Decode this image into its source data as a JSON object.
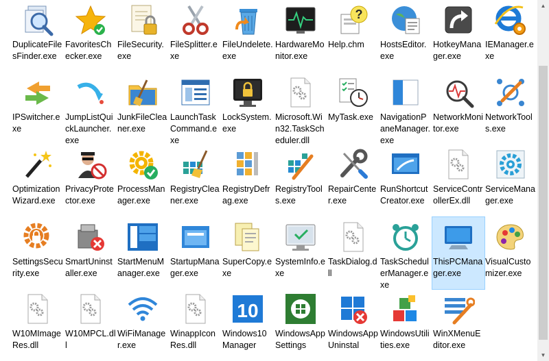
{
  "files": [
    {
      "name": "DuplicateFilesFinder.exe",
      "icon": "magnifier-files-icon"
    },
    {
      "name": "FavoritesChecker.exe",
      "icon": "star-check-icon"
    },
    {
      "name": "FileSecurity.exe",
      "icon": "document-lock-icon"
    },
    {
      "name": "FileSplitter.exe",
      "icon": "scissors-icon"
    },
    {
      "name": "FileUndelete.exe",
      "icon": "recycle-bin-undo-icon"
    },
    {
      "name": "HardwareMonitor.exe",
      "icon": "heartbeat-monitor-icon"
    },
    {
      "name": "Help.chm",
      "icon": "help-question-icon"
    },
    {
      "name": "HostsEditor.exe",
      "icon": "globe-notepad-icon"
    },
    {
      "name": "HotkeyManager.exe",
      "icon": "shortcut-arrow-key-icon"
    },
    {
      "name": "IEManager.exe",
      "icon": "ie-gear-icon"
    },
    {
      "name": "IPSwitcher.exe",
      "icon": "switch-arrows-icon"
    },
    {
      "name": "JumpListQuickLauncher.exe",
      "icon": "curved-arrow-icon"
    },
    {
      "name": "JunkFileCleaner.exe",
      "icon": "folder-broom-icon"
    },
    {
      "name": "LaunchTaskCommand.exe",
      "icon": "window-list-icon"
    },
    {
      "name": "LockSystem.exe",
      "icon": "monitor-lock-icon"
    },
    {
      "name": "Microsoft.Win32.TaskScheduler.dll",
      "icon": "dll-gear-icon"
    },
    {
      "name": "MyTask.exe",
      "icon": "checklist-clock-icon"
    },
    {
      "name": "NavigationPaneManager.exe",
      "icon": "navigation-pane-icon"
    },
    {
      "name": "NetworkMonitor.exe",
      "icon": "pulse-magnifier-icon"
    },
    {
      "name": "NetworkTools.exe",
      "icon": "network-wrench-icon"
    },
    {
      "name": "OptimizationWizard.exe",
      "icon": "magic-wand-icon"
    },
    {
      "name": "PrivacyProtector.exe",
      "icon": "spy-block-icon"
    },
    {
      "name": "ProcessManager.exe",
      "icon": "gear-check-icon"
    },
    {
      "name": "RegistryCleaner.exe",
      "icon": "registry-broom-icon"
    },
    {
      "name": "RegistryDefrag.exe",
      "icon": "registry-compress-icon"
    },
    {
      "name": "RegistryTools.exe",
      "icon": "registry-wrench-icon"
    },
    {
      "name": "RepairCenter.exe",
      "icon": "wrench-screwdriver-icon"
    },
    {
      "name": "RunShortcutCreator.exe",
      "icon": "run-window-icon"
    },
    {
      "name": "ServiceControllerEx.dll",
      "icon": "dll-gear-icon"
    },
    {
      "name": "ServiceManager.exe",
      "icon": "service-gear-icon"
    },
    {
      "name": "SettingsSecurity.exe",
      "icon": "gear-lock-icon"
    },
    {
      "name": "SmartUninstaller.exe",
      "icon": "uninstall-box-icon"
    },
    {
      "name": "StartMenuManager.exe",
      "icon": "start-menu-icon"
    },
    {
      "name": "StartupManager.exe",
      "icon": "startup-window-icon"
    },
    {
      "name": "SuperCopy.exe",
      "icon": "copy-documents-icon"
    },
    {
      "name": "SystemInfo.exe",
      "icon": "monitor-check-icon"
    },
    {
      "name": "TaskDialog.dll",
      "icon": "dll-gear-icon"
    },
    {
      "name": "TaskSchedulerManager.exe",
      "icon": "alarm-clock-icon"
    },
    {
      "name": "ThisPCManager.exe",
      "icon": "computer-icon"
    },
    {
      "name": "VisualCustomizer.exe",
      "icon": "paint-palette-icon"
    },
    {
      "name": "W10MImageRes.dll",
      "icon": "dll-gear-icon"
    },
    {
      "name": "W10MPCL.dll",
      "icon": "dll-gear-icon"
    },
    {
      "name": "WiFiManager.exe",
      "icon": "wifi-icon"
    },
    {
      "name": "WinappIconRes.dll",
      "icon": "dll-gear-icon"
    },
    {
      "name": "Windows10Manager",
      "icon": "windows10-logo-icon"
    },
    {
      "name": "WindowsAppSettings",
      "icon": "windows-store-icon"
    },
    {
      "name": "WindowsAppUninstal",
      "icon": "windows-remove-icon"
    },
    {
      "name": "WindowsUtilities.exe",
      "icon": "stacked-blocks-icon"
    },
    {
      "name": "WinXMenuEditor.exe",
      "icon": "list-wrench-icon"
    }
  ],
  "selected": "ThisPCManager.exe",
  "colors": {
    "selection": "#cce8ff",
    "selection_border": "#99d1ff",
    "scrollbar_thumb": "#cdcdcd"
  }
}
